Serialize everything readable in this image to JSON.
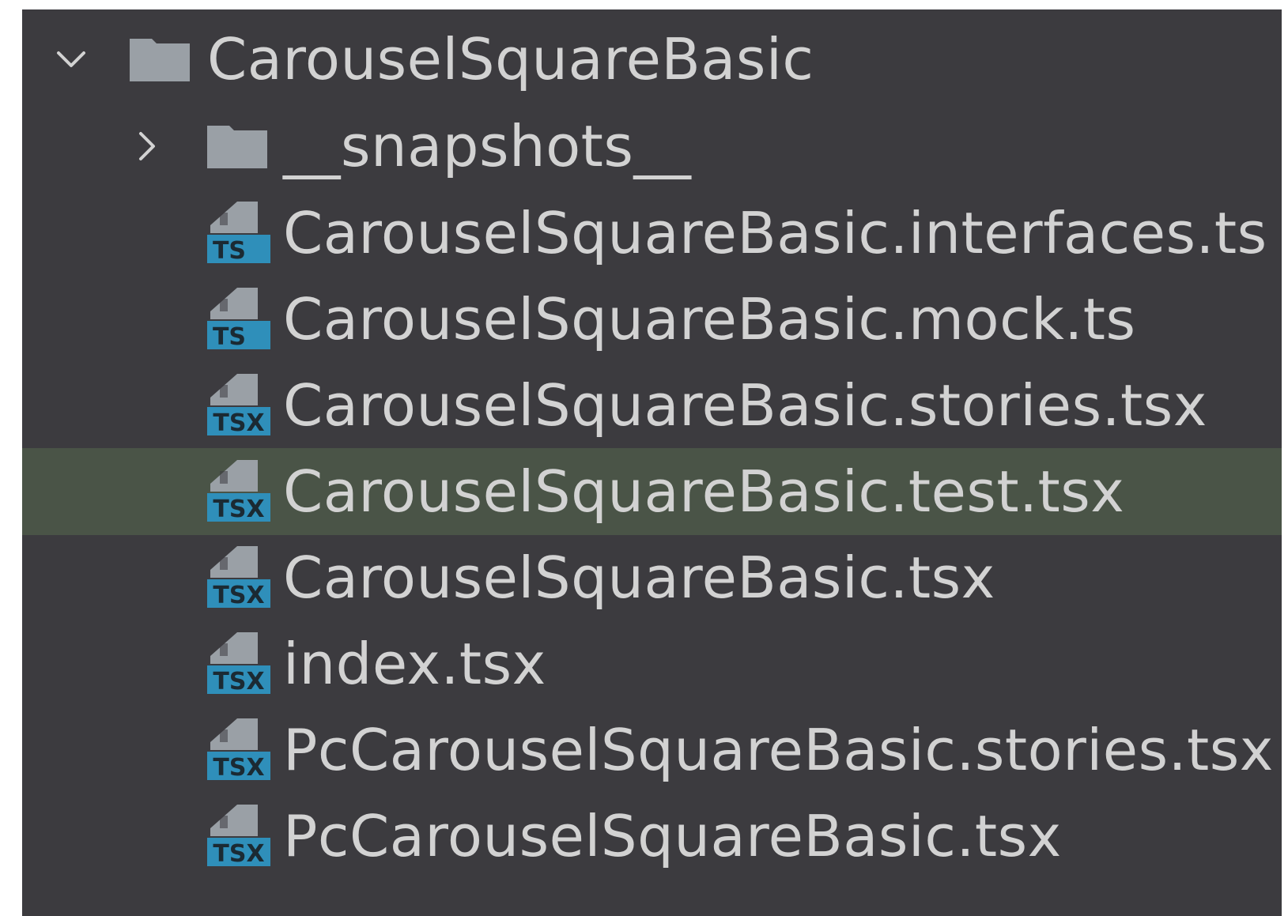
{
  "colors": {
    "panel_bg": "#3c3b3f",
    "selected_row_bg": "#4a5447",
    "text": "#d2d2d2",
    "icon_gray": "#9aa0a6",
    "ts_badge": "#2f8fba"
  },
  "tree": {
    "root": {
      "label": "CarouselSquareBasic",
      "expanded": true,
      "icon": "folder-icon",
      "toggle_icon": "chevron-down-icon"
    },
    "snapshots": {
      "label": "__snapshots__",
      "expanded": false,
      "icon": "folder-icon",
      "toggle_icon": "chevron-right-icon"
    },
    "files": [
      {
        "label": "CarouselSquareBasic.interfaces.ts",
        "badge": "TS",
        "icon": "typescript-file-icon",
        "selected": false
      },
      {
        "label": "CarouselSquareBasic.mock.ts",
        "badge": "TS",
        "icon": "typescript-file-icon",
        "selected": false
      },
      {
        "label": "CarouselSquareBasic.stories.tsx",
        "badge": "TSX",
        "icon": "tsx-file-icon",
        "selected": false
      },
      {
        "label": "CarouselSquareBasic.test.tsx",
        "badge": "TSX",
        "icon": "tsx-file-icon",
        "selected": true
      },
      {
        "label": "CarouselSquareBasic.tsx",
        "badge": "TSX",
        "icon": "tsx-file-icon",
        "selected": false
      },
      {
        "label": "index.tsx",
        "badge": "TSX",
        "icon": "tsx-file-icon",
        "selected": false
      },
      {
        "label": "PcCarouselSquareBasic.stories.tsx",
        "badge": "TSX",
        "icon": "tsx-file-icon",
        "selected": false
      },
      {
        "label": "PcCarouselSquareBasic.tsx",
        "badge": "TSX",
        "icon": "tsx-file-icon",
        "selected": false
      }
    ]
  }
}
